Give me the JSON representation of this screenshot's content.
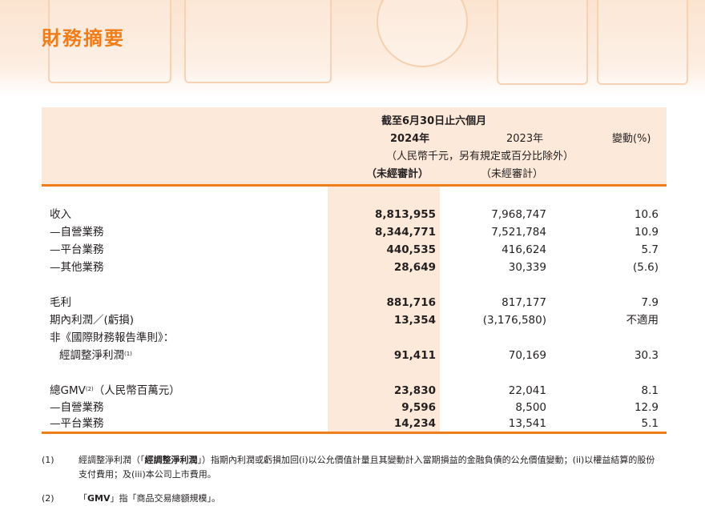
{
  "page_title": "財務摘要",
  "header": {
    "period": "截至6月30日止六個月",
    "year_2024": "2024年",
    "year_2023": "2023年",
    "change": "變動(%)",
    "unit_note": "（人民幣千元，另有規定或百分比除外）",
    "audit_2024": "（未經審計）",
    "audit_2023": "（未經審計）"
  },
  "rows": [
    {
      "label": "收入",
      "v2024": "8,813,955",
      "v2023": "7,968,747",
      "change": "10.6"
    },
    {
      "label": "—自營業務",
      "v2024": "8,344,771",
      "v2023": "7,521,784",
      "change": "10.9"
    },
    {
      "label": "—平台業務",
      "v2024": "440,535",
      "v2023": "416,624",
      "change": "5.7"
    },
    {
      "label": "—其他業務",
      "v2024": "28,649",
      "v2023": "30,339",
      "change": "(5.6)"
    },
    {
      "label": "毛利",
      "v2024": "881,716",
      "v2023": "817,177",
      "change": "7.9"
    },
    {
      "label": "期內利潤／(虧損)",
      "v2024": "13,354",
      "v2023": "(3,176,580)",
      "change": "不適用"
    },
    {
      "label": "非《國際財務報告準則》：",
      "v2024": "",
      "v2023": "",
      "change": ""
    },
    {
      "label": "經調整淨利潤",
      "sup": "(1)",
      "v2024": "91,411",
      "v2023": "70,169",
      "change": "30.3"
    },
    {
      "label": "總GMV",
      "sup": "(2)",
      "label_suffix": "（人民幣百萬元）",
      "v2024": "23,830",
      "v2023": "22,041",
      "change": "8.1"
    },
    {
      "label": "—自營業務",
      "v2024": "9,596",
      "v2023": "8,500",
      "change": "12.9"
    },
    {
      "label": "—平台業務",
      "v2024": "14,234",
      "v2023": "13,541",
      "change": "5.1"
    }
  ],
  "footnotes": [
    {
      "num": "(1)",
      "text_a": "經調整淨利潤（「",
      "text_bold": "經調整淨利潤",
      "text_b": "」）指期內利潤或虧損加回(i)以公允價值計量且其變動計入當期損益的金融負債的公允價值變動；(ii)以權益結算的股份支付費用；及(iii)本公司上市費用。"
    },
    {
      "num": "(2)",
      "text_a": "「",
      "text_bold": "GMV",
      "text_b": "」指「商品交易總額規模」。"
    }
  ],
  "colors": {
    "accent": "#f07d1a",
    "highlight": "#fde9d9",
    "banner": "#fbe3cf"
  }
}
